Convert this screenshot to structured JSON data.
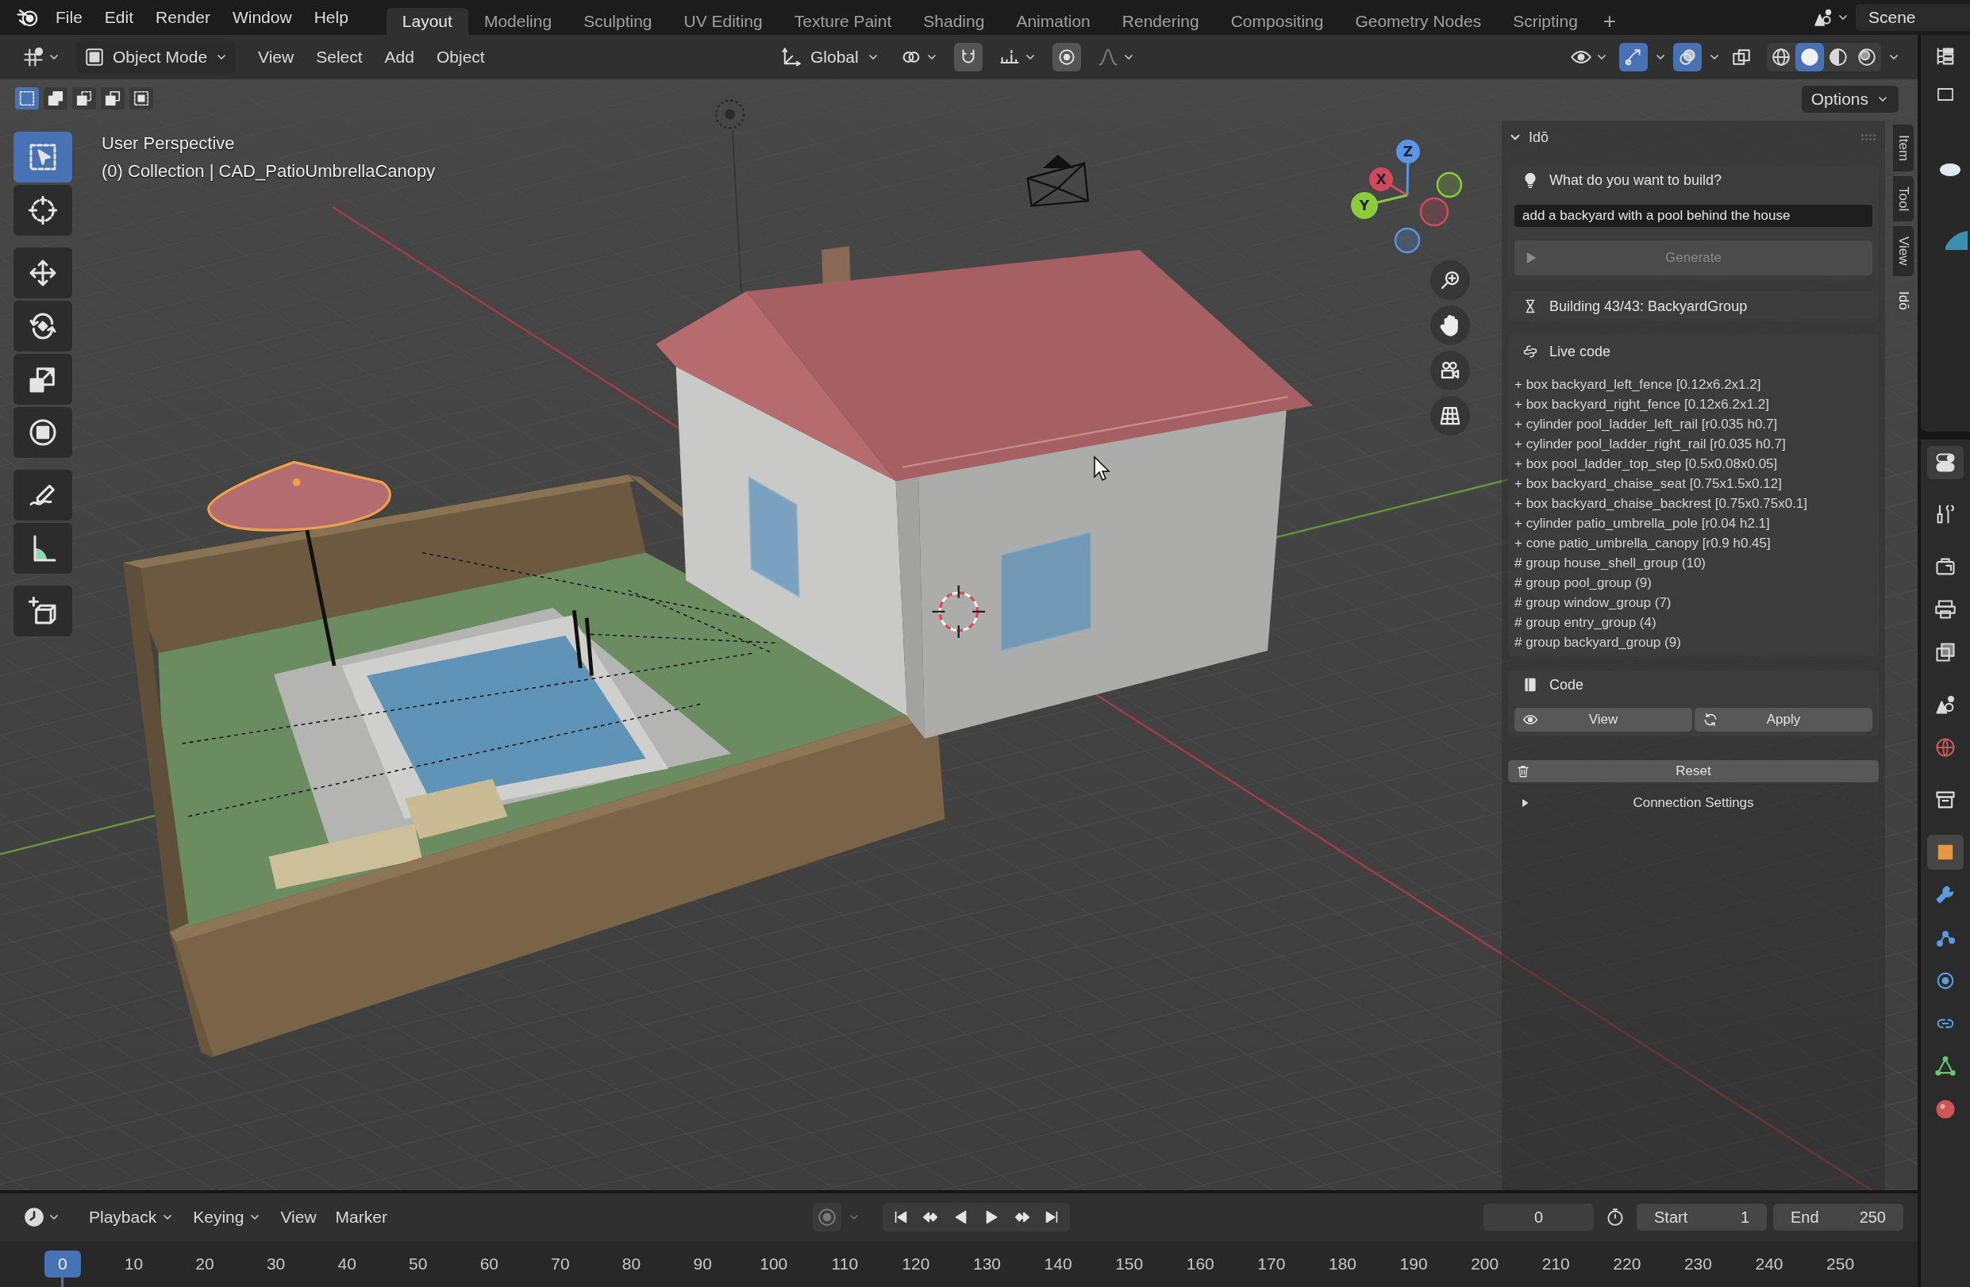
{
  "top_bar": {
    "menus": [
      "File",
      "Edit",
      "Render",
      "Window",
      "Help"
    ],
    "workspaces": [
      {
        "label": "Layout",
        "selected": true
      },
      {
        "label": "Modeling",
        "selected": false
      },
      {
        "label": "Sculpting",
        "selected": false
      },
      {
        "label": "UV Editing",
        "selected": false
      },
      {
        "label": "Texture Paint",
        "selected": false
      },
      {
        "label": "Shading",
        "selected": false
      },
      {
        "label": "Animation",
        "selected": false
      },
      {
        "label": "Rendering",
        "selected": false
      },
      {
        "label": "Compositing",
        "selected": false
      },
      {
        "label": "Geometry Nodes",
        "selected": false
      },
      {
        "label": "Scripting",
        "selected": false
      }
    ],
    "add_workspace": "+",
    "scene": "Scene"
  },
  "viewport_header": {
    "mode": "Object Mode",
    "menus": [
      "View",
      "Select",
      "Add",
      "Object"
    ],
    "orientation": "Global",
    "snap": {
      "on": false
    },
    "proportional_editing": {
      "on": false
    },
    "gizmos": {
      "on": true
    },
    "overlays": {
      "on": true
    },
    "xray": {
      "on": false
    },
    "shading": [
      {
        "kind": "wireframe",
        "selected": false
      },
      {
        "kind": "solid",
        "selected": true
      },
      {
        "kind": "material",
        "selected": false
      },
      {
        "kind": "rendered",
        "selected": false
      }
    ]
  },
  "tool_settings": {
    "select_modes": [
      {
        "kind": "set",
        "selected": true
      },
      {
        "kind": "extend",
        "selected": false
      },
      {
        "kind": "subtract",
        "selected": false
      },
      {
        "kind": "difference",
        "selected": false
      },
      {
        "kind": "intersect",
        "selected": false
      }
    ],
    "options": "Options"
  },
  "toolbar": {
    "groups": [
      {
        "tools": [
          {
            "kind": "select_box",
            "selected": true
          },
          {
            "kind": "cursor",
            "selected": false
          }
        ]
      },
      {
        "tools": [
          {
            "kind": "move",
            "selected": false
          },
          {
            "kind": "rotate",
            "selected": false
          },
          {
            "kind": "scale",
            "selected": false
          },
          {
            "kind": "transform",
            "selected": false
          }
        ]
      },
      {
        "tools": [
          {
            "kind": "annotate",
            "selected": false
          },
          {
            "kind": "measure",
            "selected": false
          }
        ]
      },
      {
        "tools": [
          {
            "kind": "add_cube",
            "selected": false
          }
        ]
      }
    ]
  },
  "viewport": {
    "perspective": "User Perspective",
    "selection": "(0) Collection | CAD_PatioUmbrellaCanopy",
    "axes": [
      {
        "label": "Z",
        "color": "#5a95e6"
      },
      {
        "label": "X",
        "color": "#d2495b"
      },
      {
        "label": "Y",
        "color": "#8ccb3c"
      }
    ]
  },
  "sidebar": {
    "tabs": [
      {
        "label": "Item",
        "selected": false
      },
      {
        "label": "Tool",
        "selected": false
      },
      {
        "label": "View",
        "selected": false
      },
      {
        "label": "Idō",
        "selected": true
      }
    ],
    "panel": {
      "title": "Idō",
      "expanded": true,
      "prompt_label": "What do you want to build?",
      "prompt_value": "add a backyard with a pool behind the house",
      "generate_button": {
        "label": "Generate",
        "disabled": true
      },
      "status": "Building 43/43: BackyardGroup",
      "live_code_title": "Live code",
      "live_code_lines": [
        "+ box backyard_left_fence [0.12x6.2x1.2]",
        "+ box backyard_right_fence [0.12x6.2x1.2]",
        "+ cylinder pool_ladder_left_rail [r0.035 h0.7]",
        "+ cylinder pool_ladder_right_rail [r0.035 h0.7]",
        "+ box pool_ladder_top_step [0.5x0.08x0.05]",
        "+ box backyard_chaise_seat [0.75x1.5x0.12]",
        "+ box backyard_chaise_backrest [0.75x0.75x0.1]",
        "+ cylinder patio_umbrella_pole [r0.04 h2.1]",
        "+ cone patio_umbrella_canopy [r0.9 h0.45]",
        "# group house_shell_group (10)",
        "# group pool_group (9)",
        "# group window_group (7)",
        "# group entry_group (4)",
        "# group backyard_group (9)"
      ],
      "code_title": "Code",
      "code_buttons": [
        {
          "kind": "view",
          "label": "View"
        },
        {
          "kind": "apply",
          "label": "Apply"
        }
      ],
      "reset_button": "Reset",
      "connection_settings": {
        "label": "Connection Settings",
        "expanded": false
      }
    }
  },
  "properties_tabs": {
    "groups": [
      {
        "tabs": [
          {
            "kind": "tool",
            "selected": false
          }
        ]
      },
      {
        "tabs": [
          {
            "kind": "render",
            "selected": false
          },
          {
            "kind": "output",
            "selected": false
          },
          {
            "kind": "view_layer",
            "selected": false
          }
        ]
      },
      {
        "tabs": [
          {
            "kind": "scene",
            "selected": false
          },
          {
            "kind": "world",
            "selected": false
          }
        ]
      },
      {
        "tabs": [
          {
            "kind": "collection",
            "selected": false
          }
        ]
      },
      {
        "tabs": [
          {
            "kind": "object",
            "selected": true
          },
          {
            "kind": "modifiers",
            "selected": false
          },
          {
            "kind": "particles",
            "selected": false
          },
          {
            "kind": "physics",
            "selected": false
          },
          {
            "kind": "constraints",
            "selected": false
          },
          {
            "kind": "data",
            "selected": false
          },
          {
            "kind": "material",
            "selected": false
          }
        ]
      }
    ]
  },
  "timeline": {
    "menus": [
      {
        "label": "Playback",
        "kind": "dropdown"
      },
      {
        "label": "Keying",
        "kind": "dropdown"
      },
      {
        "label": "View",
        "kind": "menu"
      },
      {
        "label": "Marker",
        "kind": "menu"
      }
    ],
    "auto_keying": {
      "on": false
    },
    "current_frame": "0",
    "start": {
      "label": "Start",
      "value": "1"
    },
    "end": {
      "label": "End",
      "value": "250"
    },
    "playhead": "0",
    "ruler": [
      "10",
      "20",
      "30",
      "40",
      "50",
      "60",
      "70",
      "80",
      "90",
      "100",
      "110",
      "120",
      "130",
      "140",
      "150",
      "160",
      "170",
      "180",
      "190",
      "200",
      "210",
      "220",
      "230",
      "240",
      "250"
    ]
  }
}
